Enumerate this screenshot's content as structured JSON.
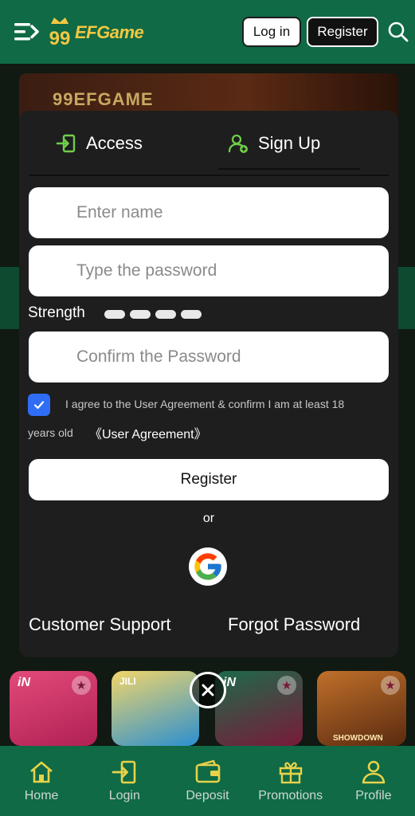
{
  "header": {
    "logo_text": "EFGame",
    "login_label": "Log in",
    "register_label": "Register"
  },
  "background": {
    "banner_text": "99EFGAME",
    "tiles": [
      {
        "label": "iN"
      },
      {
        "label": "JILI"
      },
      {
        "label": "iN"
      },
      {
        "label": "SHOWDOWN"
      }
    ]
  },
  "modal": {
    "tabs": [
      {
        "label": "Access",
        "active": false
      },
      {
        "label": "Sign Up",
        "active": true
      }
    ],
    "name_placeholder": "Enter name",
    "password_placeholder": "Type the password",
    "strength_label": "Strength",
    "strength_level": 0,
    "confirm_placeholder": "Confirm the Password",
    "agreement_checked": true,
    "agreement_text_line1": "I agree to the User Agreement & confirm I am at least 18",
    "agreement_text_line2": "years old",
    "agreement_link": "《User Agreement》",
    "register_button": "Register",
    "or_text": "or",
    "customer_support": "Customer Support",
    "forgot_password": "Forgot Password"
  },
  "bottom_nav": [
    {
      "label": "Home",
      "icon": "home-icon"
    },
    {
      "label": "Login",
      "icon": "login-icon"
    },
    {
      "label": "Deposit",
      "icon": "wallet-icon"
    },
    {
      "label": "Promotions",
      "icon": "gift-icon"
    },
    {
      "label": "Profile",
      "icon": "profile-icon"
    }
  ],
  "colors": {
    "header_green": "#0f6a45",
    "modal_bg": "#1e1e1e",
    "checkbox_blue": "#2f6df6",
    "nav_icon_yellow": "#e8d24a",
    "logo_gold": "#f3c742"
  }
}
